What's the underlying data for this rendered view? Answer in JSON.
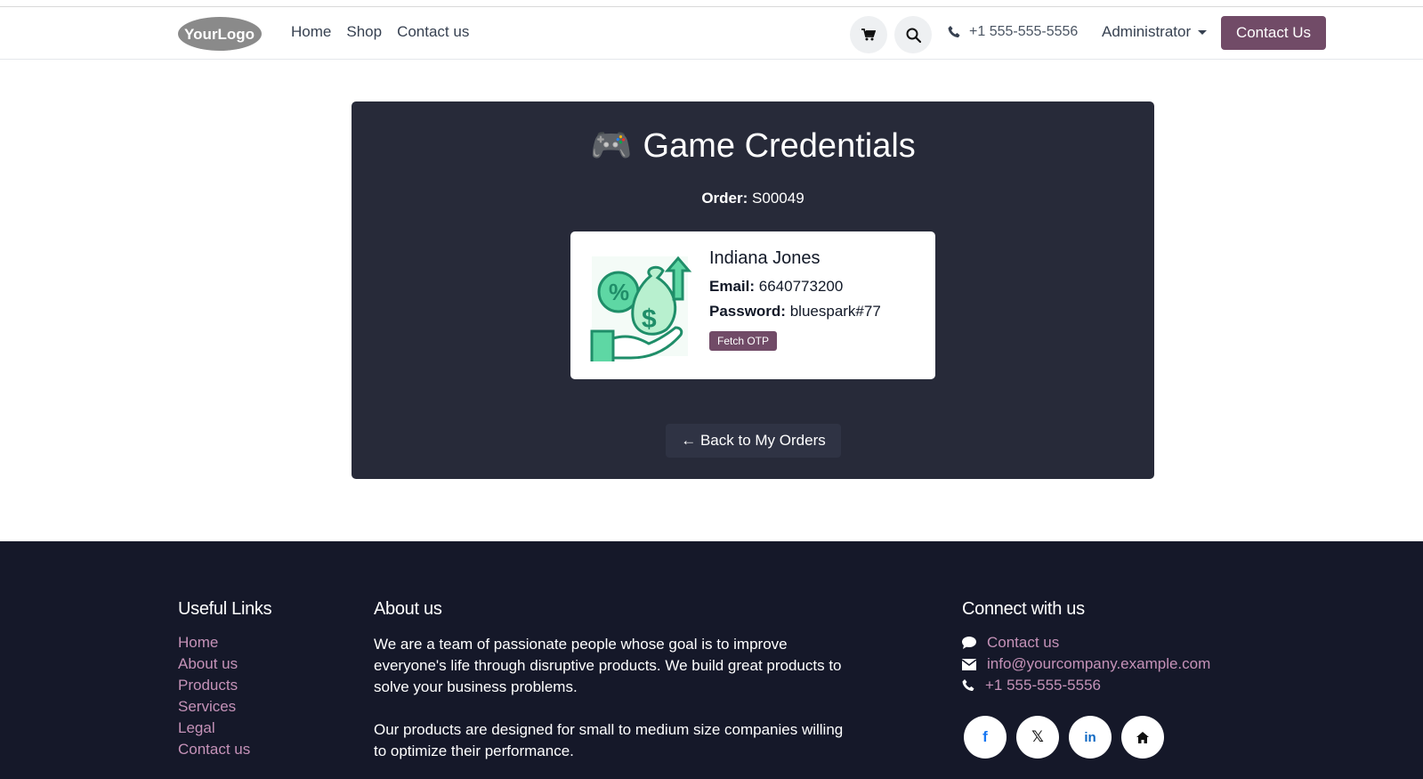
{
  "header": {
    "logo_text": "YourLogo",
    "nav": [
      "Home",
      "Shop",
      "Contact us"
    ],
    "phone": "+1 555-555-5556",
    "user": "Administrator",
    "cta": "Contact Us"
  },
  "main": {
    "title_icon": "🎮",
    "title": "Game Credentials",
    "order_label": "Order:",
    "order_value": "S00049",
    "credential": {
      "name": "Indiana Jones",
      "email_label": "Email:",
      "email_value": "6640773200",
      "password_label": "Password:",
      "password_value": "bluespark#77",
      "otp_button": "Fetch OTP"
    },
    "back_button": "← Back to My Orders"
  },
  "footer": {
    "useful_links_title": "Useful Links",
    "useful_links": [
      "Home",
      "About us",
      "Products",
      "Services",
      "Legal",
      "Contact us"
    ],
    "about_title": "About us",
    "about_p1": "We are a team of passionate people whose goal is to improve everyone's life through disruptive products. We build great products to solve your business problems.",
    "about_p2": "Our products are designed for small to medium size companies willing to optimize their performance.",
    "connect_title": "Connect with us",
    "connect": {
      "contact": "Contact us",
      "email": "info@yourcompany.example.com",
      "phone": "+1 555-555-5556"
    },
    "socials": [
      "facebook-icon",
      "x-icon",
      "linkedin-icon",
      "home-icon"
    ]
  },
  "colors": {
    "brand": "#714b67",
    "panel": "#272a39",
    "footer": "#151829",
    "link": "#c592b8"
  }
}
